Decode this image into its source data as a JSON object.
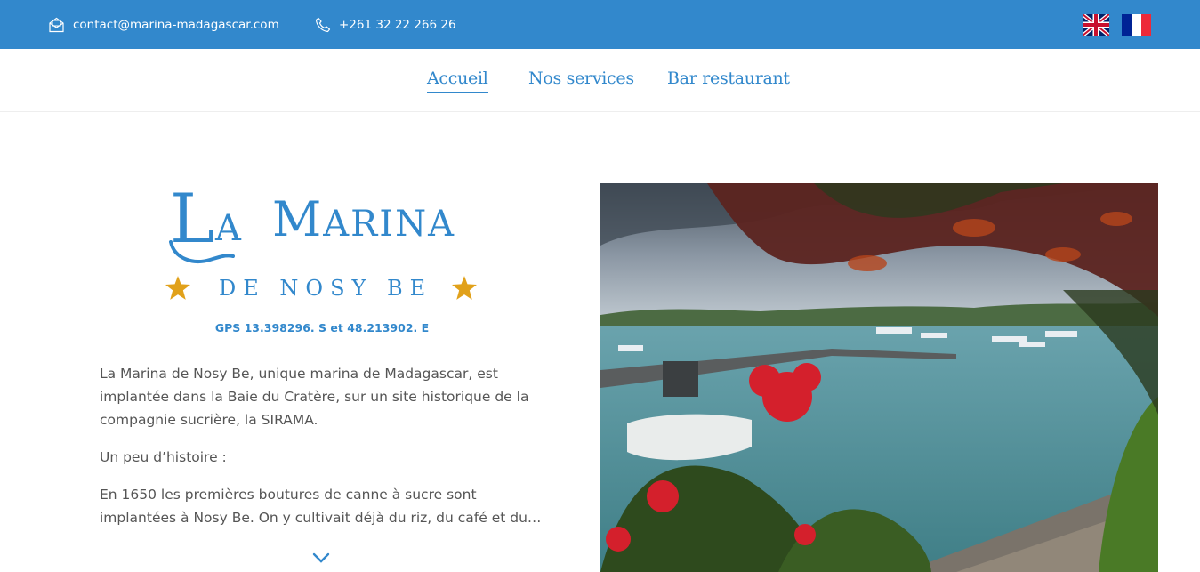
{
  "topbar": {
    "email": "contact@marina-madagascar.com",
    "phone": "+261 32 22 266 26",
    "email_icon": "envelope-icon",
    "phone_icon": "phone-icon",
    "languages": [
      "English (UK flag)",
      "Français (French flag)"
    ]
  },
  "nav": {
    "items": [
      {
        "label": "Accueil",
        "active": true
      },
      {
        "label": "Nos services",
        "active": false
      },
      {
        "label": "Bar restaurant",
        "active": false
      }
    ]
  },
  "logo": {
    "letter_l": "L",
    "word_a": "A",
    "letter_m": "M",
    "word_arina": "ARINA",
    "subtitle": "DE NOSY BE"
  },
  "gps": "GPS 13.398296. S et 48.213902. E",
  "intro": {
    "paragraph1": "La Marina de Nosy Be, unique marina de Madagascar, est implantée dans la Baie du Cratère, sur un site historique de la compagnie sucrière, la SIRAMA.",
    "paragraph2": "Un peu d’histoire :",
    "paragraph3": "En 1650 les premières boutures de canne à sucre sont implantées à Nosy Be. On y cultivait déjà du riz, du café et du…"
  },
  "colors": {
    "brand_blue": "#3288cc",
    "star_gold": "#e1a11a",
    "text_gray": "#555555"
  }
}
